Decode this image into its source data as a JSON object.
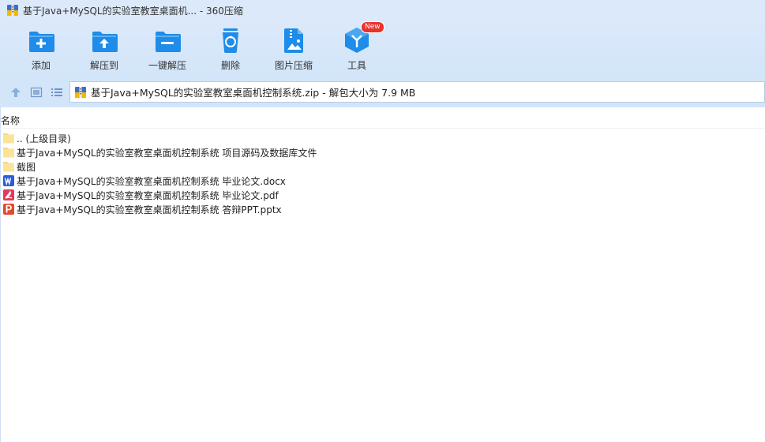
{
  "window": {
    "title": "基于Java+MySQL的实验室教室桌面机... - 360压缩"
  },
  "toolbar": {
    "items": [
      {
        "label": "添加",
        "icon": "add-folder-icon"
      },
      {
        "label": "解压到",
        "icon": "extract-to-icon"
      },
      {
        "label": "一键解压",
        "icon": "one-click-extract-icon"
      },
      {
        "label": "删除",
        "icon": "recycle-delete-icon"
      },
      {
        "label": "图片压缩",
        "icon": "image-compress-icon"
      },
      {
        "label": "工具",
        "icon": "tools-icon",
        "badge": "New"
      }
    ]
  },
  "address": {
    "path": "基于Java+MySQL的实验室教室桌面机控制系统.zip - 解包大小为 7.9 MB"
  },
  "columns": {
    "name": "名称"
  },
  "files": [
    {
      "name": ".. (上级目录)",
      "type": "folder"
    },
    {
      "name": "基于Java+MySQL的实验室教室桌面机控制系统 项目源码及数据库文件",
      "type": "folder"
    },
    {
      "name": "截图",
      "type": "folder"
    },
    {
      "name": "基于Java+MySQL的实验室教室桌面机控制系统 毕业论文.docx",
      "type": "docx"
    },
    {
      "name": "基于Java+MySQL的实验室教室桌面机控制系统 毕业论文.pdf",
      "type": "pdf"
    },
    {
      "name": "基于Java+MySQL的实验室教室桌面机控制系统 答辩PPT.pptx",
      "type": "pptx"
    }
  ],
  "colors": {
    "toolbar_bg": "#d3e5f9",
    "icon_blue": "#1e8ce8",
    "folder_yellow": "#f8d775",
    "word_blue": "#2b5cd8",
    "pdf_red": "#e23a5c",
    "ppt_red": "#e04b2d",
    "badge_red": "#e8322e"
  }
}
